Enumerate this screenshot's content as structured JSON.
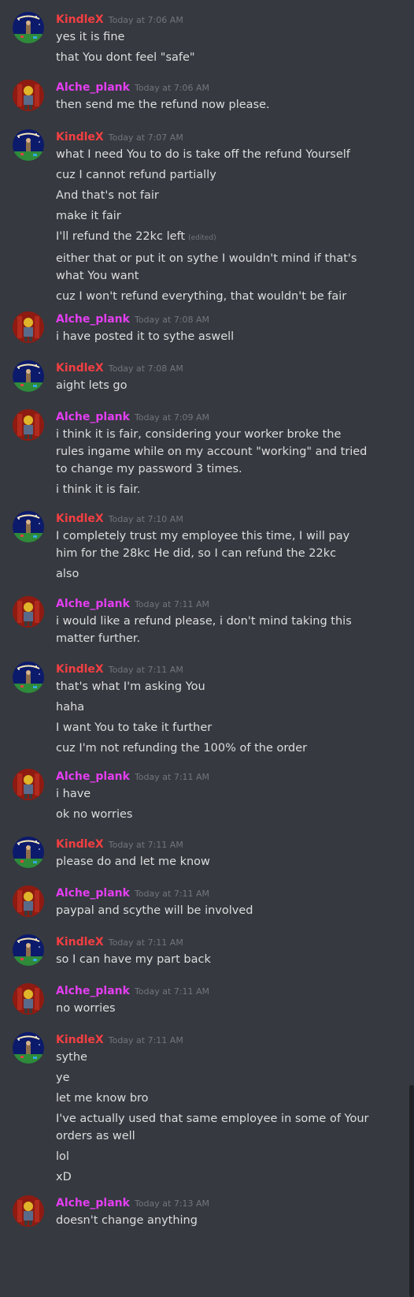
{
  "users": {
    "kindle": {
      "name": "KindleX",
      "color": "#f23f42"
    },
    "alche": {
      "name": "Alche_plank",
      "color": "#e33ef1"
    }
  },
  "messages": [
    {
      "user": "kindle",
      "time": "Today at 7:06 AM",
      "lines": [
        "yes it is fine",
        "that You dont feel \"safe\""
      ]
    },
    {
      "user": "alche",
      "time": "Today at 7:06 AM",
      "lines": [
        "then send me the refund now please."
      ]
    },
    {
      "user": "kindle",
      "time": "Today at 7:07 AM",
      "lines": [
        "what I need You to do is take off the refund Yourself",
        "cuz I cannot refund partially",
        "And that's not fair",
        "make it fair",
        "I'll refund the 22kc left",
        "either that or put it on sythe I wouldn't mind if that's what You want",
        "cuz I won't refund everything, that wouldn't be fair"
      ],
      "edited_line": 4,
      "edited_label": "(edited)"
    },
    {
      "user": "alche",
      "time": "Today at 7:08 AM",
      "lines": [
        "i have posted it to sythe aswell"
      ]
    },
    {
      "user": "kindle",
      "time": "Today at 7:08 AM",
      "lines": [
        "aight lets go"
      ]
    },
    {
      "user": "alche",
      "time": "Today at 7:09 AM",
      "lines": [
        "i think it is fair, considering your worker broke the rules ingame while on my account \"working\" and tried to change my password 3 times.",
        "i think it is fair."
      ]
    },
    {
      "user": "kindle",
      "time": "Today at 7:10 AM",
      "lines": [
        "I completely trust my employee this time, I will pay him for the 28kc He did, so I can refund the 22kc",
        "also"
      ]
    },
    {
      "user": "alche",
      "time": "Today at 7:11 AM",
      "lines": [
        "i would like a refund please, i don't mind taking this matter further."
      ]
    },
    {
      "user": "kindle",
      "time": "Today at 7:11 AM",
      "lines": [
        "that's what I'm asking You",
        "haha",
        "I want You to take it further",
        "cuz I'm not refunding the 100% of the order"
      ]
    },
    {
      "user": "alche",
      "time": "Today at 7:11 AM",
      "lines": [
        "i have",
        "ok no worries"
      ]
    },
    {
      "user": "kindle",
      "time": "Today at 7:11 AM",
      "lines": [
        "please do and let me know"
      ]
    },
    {
      "user": "alche",
      "time": "Today at 7:11 AM",
      "lines": [
        "paypal and scythe will be involved"
      ]
    },
    {
      "user": "kindle",
      "time": "Today at 7:11 AM",
      "lines": [
        "so I can have my part back"
      ]
    },
    {
      "user": "alche",
      "time": "Today at 7:11 AM",
      "lines": [
        "no worries"
      ]
    },
    {
      "user": "kindle",
      "time": "Today at 7:11 AM",
      "lines": [
        "sythe",
        "ye",
        "let me know bro",
        "I've actually used that same employee in some of Your orders as well",
        "lol",
        "xD"
      ]
    },
    {
      "user": "alche",
      "time": "Today at 7:13 AM",
      "lines": [
        "doesn't change anything"
      ]
    }
  ]
}
